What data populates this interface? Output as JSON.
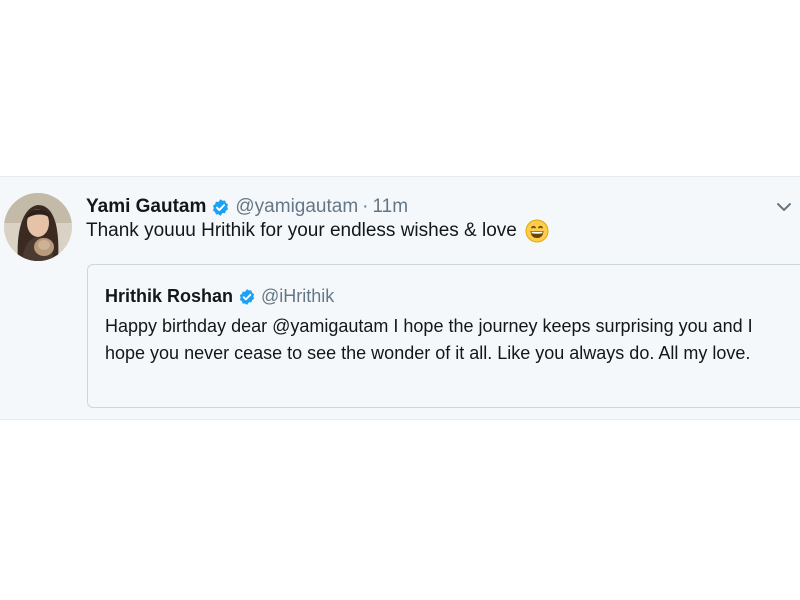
{
  "tweet": {
    "author_name": "Yami Gautam",
    "author_handle": "@yamigautam",
    "separator": "·",
    "time": "11m",
    "text": "Thank youuu Hrithik for your endless wishes & love",
    "emoji": "grinning-face-emoji"
  },
  "quoted_tweet": {
    "author_name": "Hrithik Roshan",
    "author_handle": "@iHrithik",
    "text": "Happy birthday dear @yamigautam I hope the journey keeps surprising you and I hope you never cease to see the wonder of it all. Like you always do. All my love."
  },
  "icons": {
    "verified": "verified-badge-icon",
    "menu": "chevron-down-icon"
  },
  "colors": {
    "tweet_background": "#f5f8fa",
    "verified_blue": "#1da1f2",
    "secondary_text": "#657786",
    "primary_text": "#14171a",
    "border": "#ccd6dd"
  }
}
